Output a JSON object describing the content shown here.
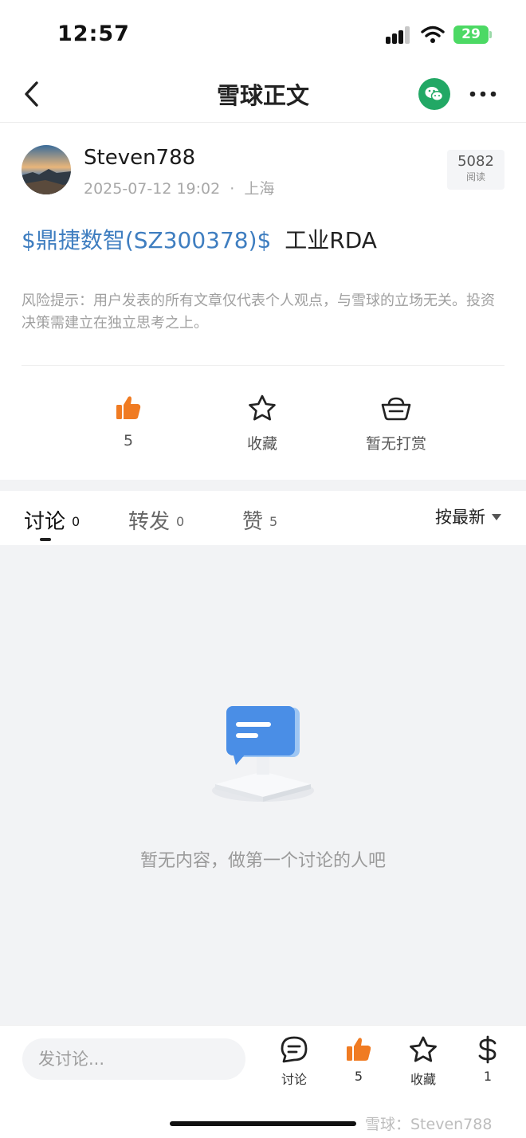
{
  "status_bar": {
    "time": "12:57",
    "battery": "29"
  },
  "nav": {
    "title": "雪球正文"
  },
  "post": {
    "author": "Steven788",
    "date": "2025-07-12 19:02",
    "separator": "·",
    "location": "上海",
    "reads_count": "5082",
    "reads_label": "阅读",
    "stock_tag": "$鼎捷数智(SZ300378)$",
    "text": "工业RDA",
    "disclaimer": "风险提示：用户发表的所有文章仅代表个人观点，与雪球的立场无关。投资决策需建立在独立思考之上。"
  },
  "actions": {
    "like_count": "5",
    "favorite_label": "收藏",
    "reward_label": "暂无打赏"
  },
  "tabs": [
    {
      "label": "讨论",
      "count": "0",
      "active": true
    },
    {
      "label": "转发",
      "count": "0",
      "active": false
    },
    {
      "label": "赞",
      "count": "5",
      "active": false
    }
  ],
  "sort": {
    "label": "按最新"
  },
  "empty": {
    "text": "暂无内容，做第一个讨论的人吧"
  },
  "bottom": {
    "input_placeholder": "发讨论...",
    "discuss_label": "讨论",
    "like_count": "5",
    "favorite_label": "收藏",
    "reward_count": "1"
  },
  "watermark": "雪球：Steven788",
  "colors": {
    "stock_link": "#3f7ec0",
    "like_orange": "#f07b22",
    "wechat_green": "#22a865",
    "empty_bg": "#f2f3f5"
  },
  "icons": [
    "back-arrow-icon",
    "wechat-icon",
    "more-icon",
    "thumbs-up-icon",
    "star-icon",
    "reward-basket-icon",
    "chat-bubble-icon",
    "dollar-icon"
  ]
}
